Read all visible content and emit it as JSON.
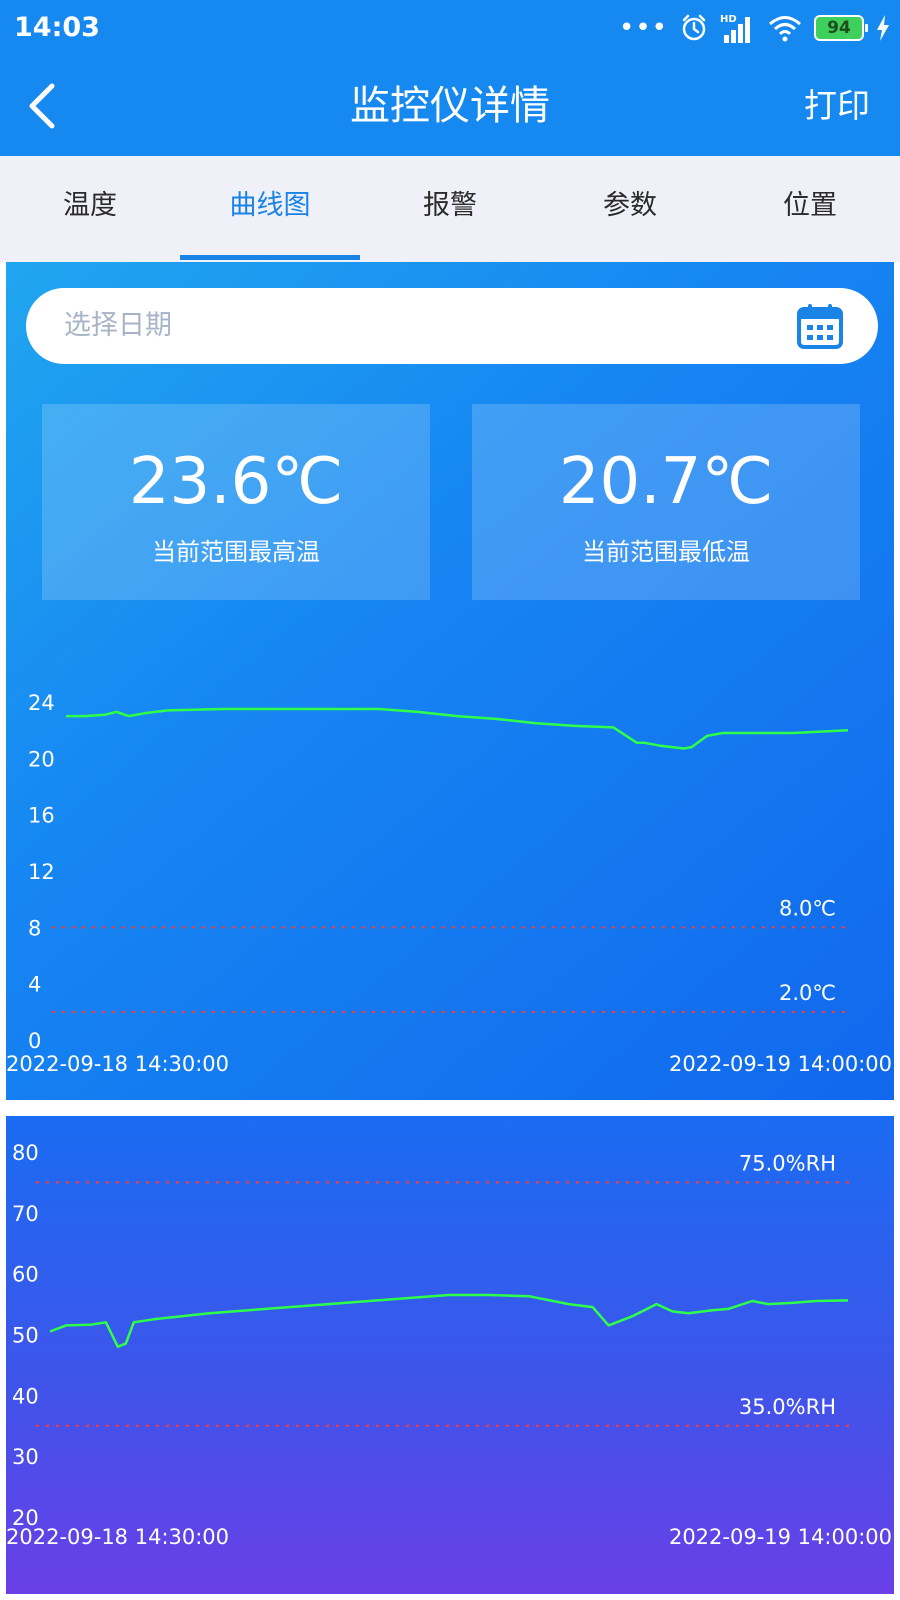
{
  "status_bar": {
    "time": "14:03",
    "battery": "94",
    "network_badge": "HD"
  },
  "nav": {
    "title": "监控仪详情",
    "action": "打印"
  },
  "tabs": [
    {
      "label": "温度",
      "active": false
    },
    {
      "label": "曲线图",
      "active": true
    },
    {
      "label": "报警",
      "active": false
    },
    {
      "label": "参数",
      "active": false
    },
    {
      "label": "位置",
      "active": false
    }
  ],
  "date_picker": {
    "placeholder": "选择日期"
  },
  "stats": {
    "max": {
      "value": "23.6℃",
      "label": "当前范围最高温"
    },
    "min": {
      "value": "20.7℃",
      "label": "当前范围最低温"
    }
  },
  "colors": {
    "primary": "#1689f0",
    "line": "#2eff4a",
    "threshold": "#ff3b30"
  },
  "chart_data": [
    {
      "type": "line",
      "ylim": [
        0,
        24
      ],
      "yticks": [
        0,
        4,
        8,
        12,
        16,
        20,
        24
      ],
      "x_start_label": "2022-09-18 14:30:00",
      "x_end_label": "2022-09-19 14:00:00",
      "thresholds": [
        {
          "value": 8.0,
          "label": "8.0℃"
        },
        {
          "value": 2.0,
          "label": "2.0℃"
        }
      ],
      "x": [
        0,
        0.025,
        0.05,
        0.065,
        0.08,
        0.1,
        0.13,
        0.2,
        0.3,
        0.4,
        0.45,
        0.5,
        0.55,
        0.6,
        0.65,
        0.7,
        0.73,
        0.74,
        0.76,
        0.79,
        0.8,
        0.82,
        0.84,
        0.88,
        0.93,
        1.0
      ],
      "values": [
        23.0,
        23.0,
        23.1,
        23.3,
        23.0,
        23.2,
        23.4,
        23.5,
        23.5,
        23.5,
        23.3,
        23.0,
        22.8,
        22.5,
        22.3,
        22.2,
        21.1,
        21.1,
        20.9,
        20.7,
        20.8,
        21.6,
        21.8,
        21.8,
        21.8,
        22.0
      ]
    },
    {
      "type": "line",
      "ylim": [
        20,
        80
      ],
      "yticks": [
        20,
        30,
        40,
        50,
        60,
        70,
        80
      ],
      "x_start_label": "2022-09-18 14:30:00",
      "x_end_label": "2022-09-19 14:00:00",
      "thresholds": [
        {
          "value": 75.0,
          "label": "75.0%RH"
        },
        {
          "value": 35.0,
          "label": "35.0%RH"
        }
      ],
      "x": [
        0,
        0.02,
        0.05,
        0.07,
        0.085,
        0.095,
        0.105,
        0.13,
        0.2,
        0.3,
        0.4,
        0.5,
        0.55,
        0.6,
        0.65,
        0.68,
        0.7,
        0.73,
        0.76,
        0.78,
        0.8,
        0.83,
        0.85,
        0.88,
        0.9,
        0.93,
        0.96,
        1.0
      ],
      "values": [
        50.5,
        51.5,
        51.6,
        52.0,
        48.0,
        48.5,
        52.0,
        52.5,
        53.5,
        54.5,
        55.5,
        56.5,
        56.5,
        56.3,
        55.0,
        54.5,
        51.5,
        53.0,
        55.0,
        53.8,
        53.5,
        54.0,
        54.2,
        55.5,
        55.0,
        55.2,
        55.5,
        55.6
      ]
    }
  ]
}
